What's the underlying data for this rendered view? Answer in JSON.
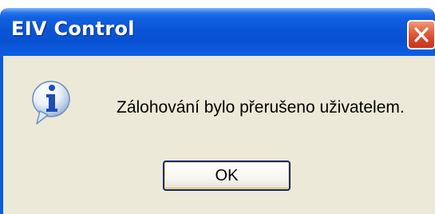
{
  "window": {
    "title": "EIV Control",
    "close_icon": "close-icon"
  },
  "dialog": {
    "icon": "information-icon",
    "message": "Zálohování bylo přerušeno uživatelem.",
    "ok_label": "OK"
  },
  "colors": {
    "titlebar": "#0a55d6",
    "client_background": "#ece9d8",
    "close_button": "#d2442a"
  }
}
